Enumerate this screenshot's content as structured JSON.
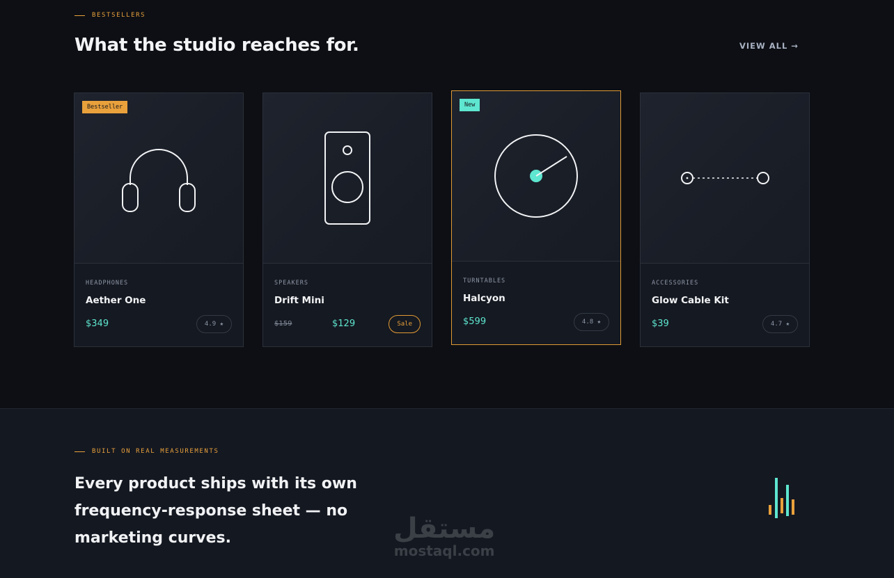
{
  "bestsellers": {
    "eyebrow": "BESTSELLERS",
    "title": "What the studio reaches for.",
    "view_all": "VIEW ALL →"
  },
  "products": [
    {
      "badge": "Bestseller",
      "category": "HEADPHONES",
      "name": "Aether One",
      "price": "$349",
      "rating": "4.9 ★",
      "icon": "headphones-icon"
    },
    {
      "badge": "",
      "category": "SPEAKERS",
      "name": "Drift Mini",
      "old_price": "$159",
      "price": "$129",
      "tag": "Sale",
      "icon": "speaker-icon"
    },
    {
      "badge": "New",
      "category": "TURNTABLES",
      "name": "Halcyon",
      "price": "$599",
      "rating": "4.8 ★",
      "icon": "turntable-icon"
    },
    {
      "badge": "",
      "category": "ACCESSORIES",
      "name": "Glow Cable Kit",
      "price": "$39",
      "rating": "4.7 ★",
      "icon": "cable-icon"
    }
  ],
  "measurements": {
    "eyebrow": "BUILT ON REAL MEASUREMENTS",
    "headline": "Every product ships with its own frequency-response sheet — no marketing curves."
  },
  "watermark": {
    "arabic": "مستقل",
    "latin": "mostaql.com"
  },
  "colors": {
    "background": "#0d0f14",
    "accent_orange": "#e9a13c",
    "accent_teal": "#5ee6d0"
  }
}
